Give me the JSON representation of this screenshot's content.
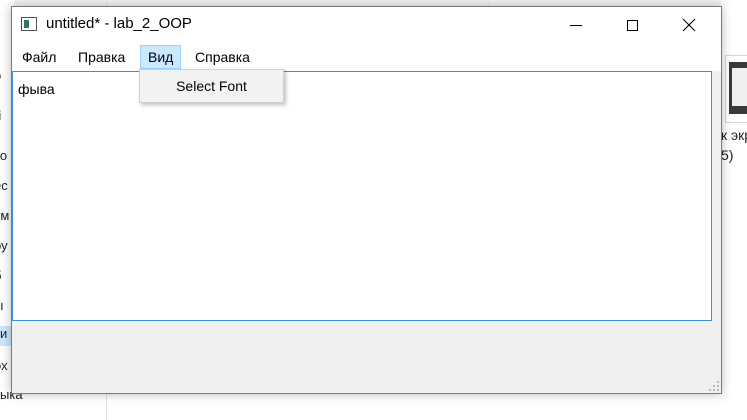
{
  "window": {
    "title": "untitled* - lab_2_OOP"
  },
  "menubar": {
    "items": [
      {
        "label": "Файл"
      },
      {
        "label": "Правка"
      },
      {
        "label": "Вид"
      },
      {
        "label": "Справка"
      }
    ],
    "active_item": "Вид"
  },
  "dropdown": {
    "items": [
      {
        "label": "Select Font"
      }
    ]
  },
  "editor": {
    "text": "фыва"
  },
  "background": {
    "left_fragments": [
      "o",
      "ri",
      "ко",
      "ec",
      "ум",
      "ру",
      "б",
      "ы",
      "и",
      "ох"
    ],
    "right_fragments": [
      "к экр",
      "5)"
    ],
    "bottom_fragment": "ыка"
  },
  "colors": {
    "menu_highlight": "#cce8ff",
    "menu_highlight_border": "#99d1ff",
    "editor_focus_border": "#3c8fd4",
    "window_background": "#f0f0f0"
  },
  "icons": {
    "app": "app-icon",
    "minimize": "minimize-icon",
    "maximize": "maximize-icon",
    "close": "close-icon"
  }
}
